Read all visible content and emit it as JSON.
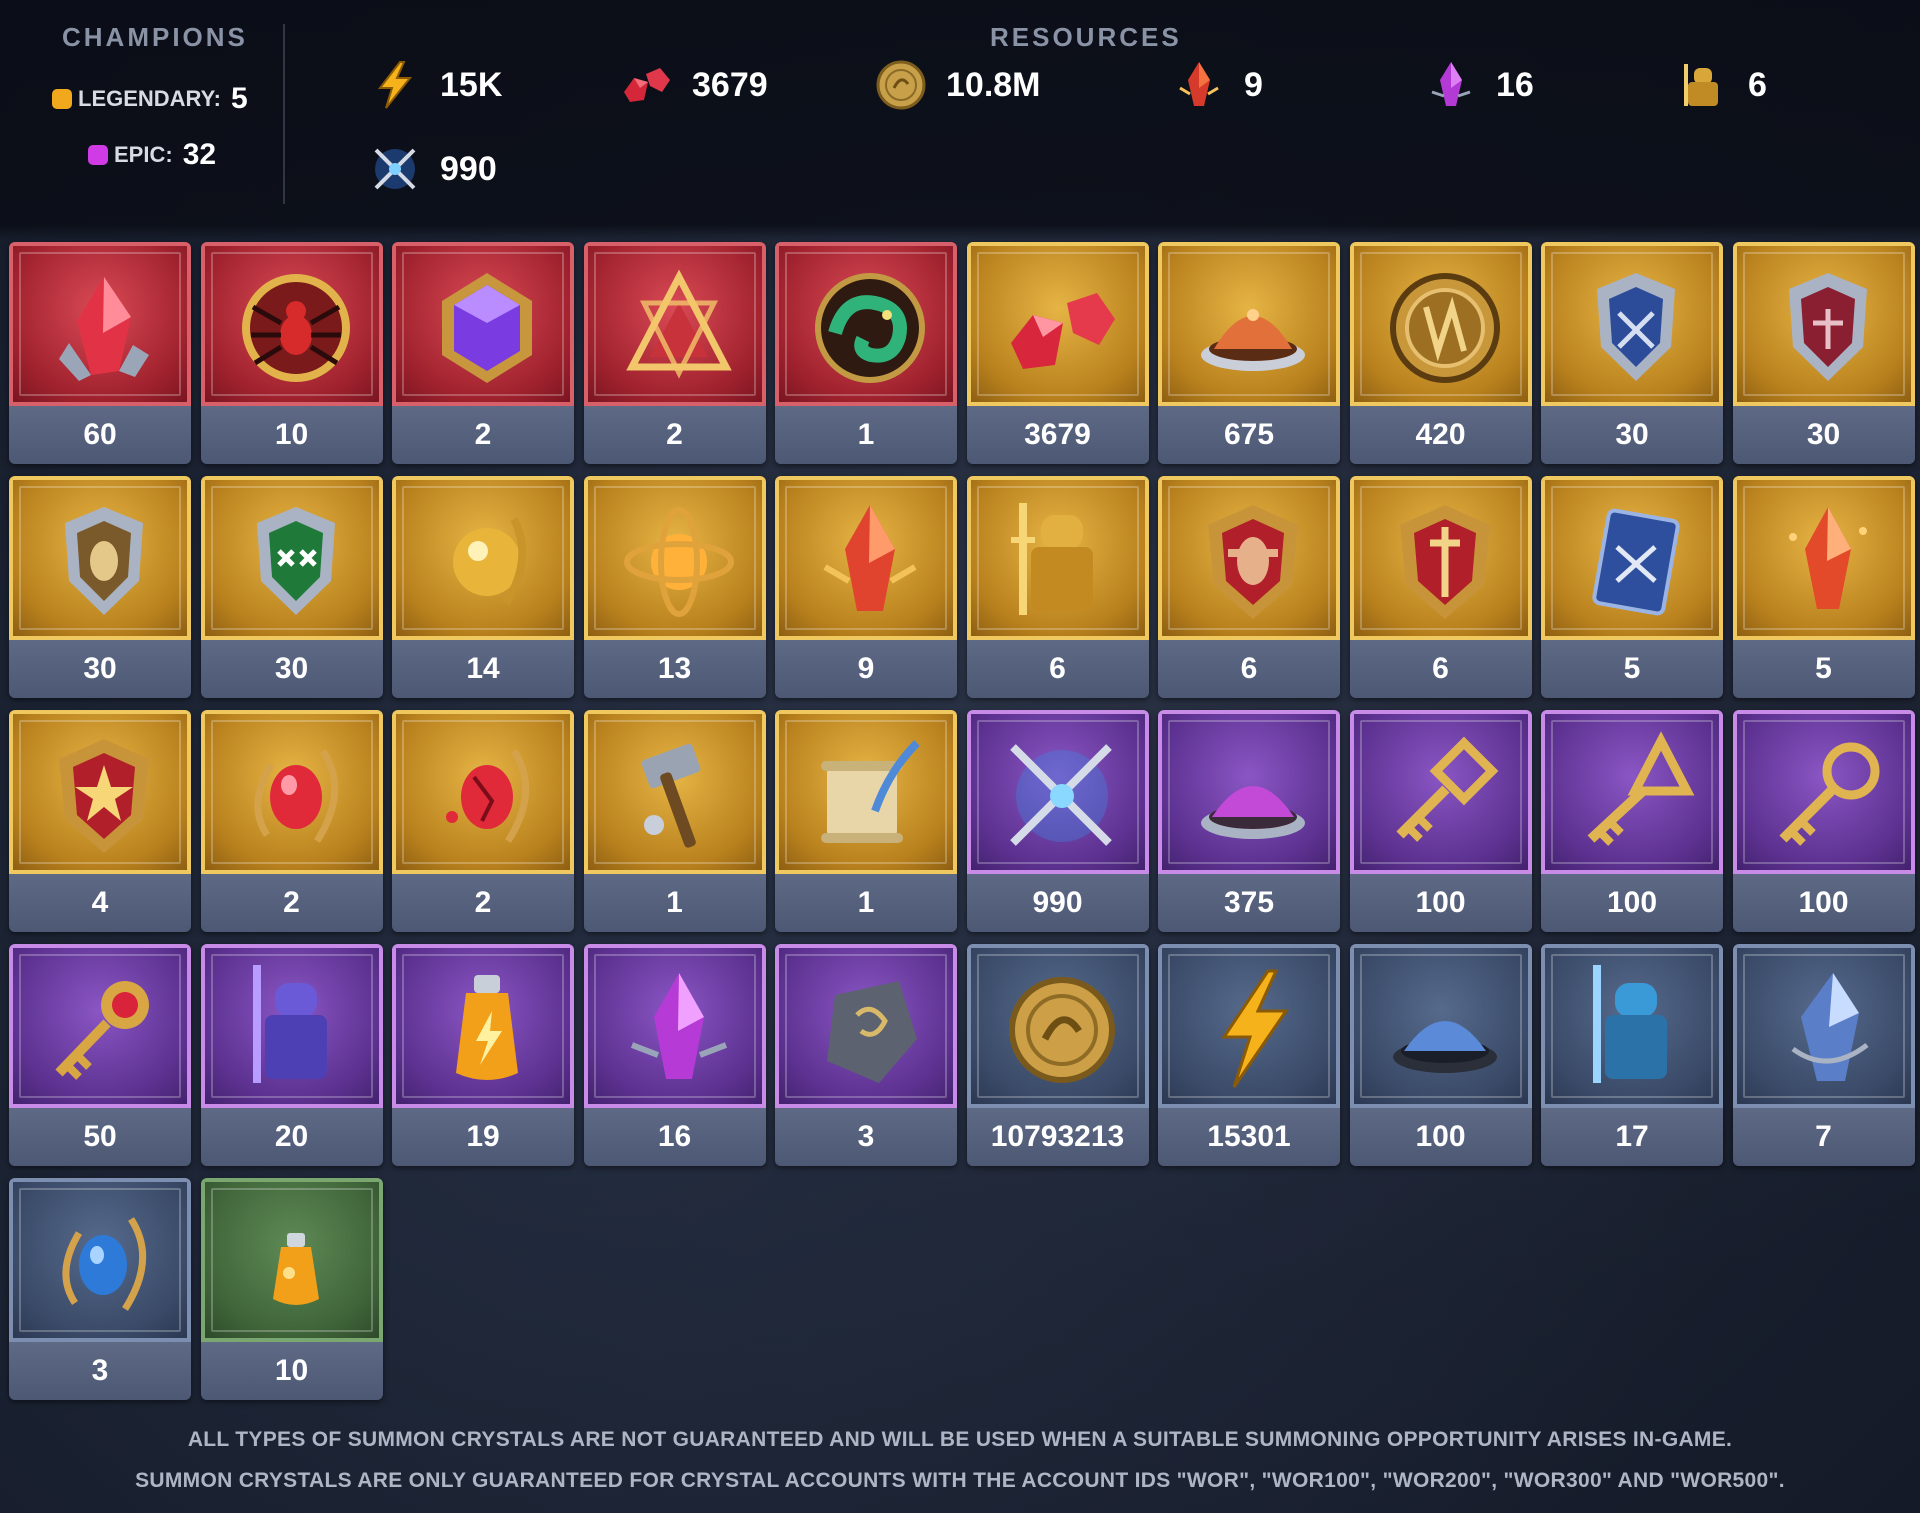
{
  "header": {
    "champions_title": "CHAMPIONS",
    "resources_title": "RESOURCES",
    "champions": [
      {
        "label": "LEGENDARY:",
        "value": "5",
        "color": "#f2a81d"
      },
      {
        "label": "EPIC:",
        "value": "32",
        "color": "#d13be6"
      }
    ],
    "resources": [
      {
        "icon": "energy-bolt-icon",
        "value": "15K"
      },
      {
        "icon": "ruby-gems-icon",
        "value": "3679"
      },
      {
        "icon": "silver-coin-icon",
        "value": "10.8M"
      },
      {
        "icon": "red-shard-icon",
        "value": "9"
      },
      {
        "icon": "purple-shard-icon",
        "value": "16"
      },
      {
        "icon": "golden-knight-icon",
        "value": "6"
      },
      {
        "icon": "crossed-swords-icon",
        "value": "990"
      }
    ]
  },
  "items": [
    {
      "icon": "red-crystal-icon",
      "rarity": "red",
      "count": "60"
    },
    {
      "icon": "spider-medallion-icon",
      "rarity": "red",
      "count": "10"
    },
    {
      "icon": "violet-gem-icon",
      "rarity": "red",
      "count": "2"
    },
    {
      "icon": "triangle-relic-icon",
      "rarity": "red",
      "count": "2"
    },
    {
      "icon": "chameleon-icon",
      "rarity": "red",
      "count": "1"
    },
    {
      "icon": "ruby-gems-icon",
      "rarity": "gold",
      "count": "3679"
    },
    {
      "icon": "forge-dust-icon",
      "rarity": "gold",
      "count": "675"
    },
    {
      "icon": "gold-coin-icon",
      "rarity": "gold",
      "count": "420"
    },
    {
      "icon": "blue-shield-icon",
      "rarity": "gold",
      "count": "30"
    },
    {
      "icon": "red-shield-icon",
      "rarity": "gold",
      "count": "30"
    },
    {
      "icon": "bronze-shield-icon",
      "rarity": "gold",
      "count": "30"
    },
    {
      "icon": "green-shield-icon",
      "rarity": "gold",
      "count": "30"
    },
    {
      "icon": "golden-orb-icon",
      "rarity": "gold",
      "count": "14"
    },
    {
      "icon": "astrolabe-icon",
      "rarity": "gold",
      "count": "13"
    },
    {
      "icon": "red-shard-icon",
      "rarity": "gold",
      "count": "9"
    },
    {
      "icon": "golden-knight-icon",
      "rarity": "gold",
      "count": "6"
    },
    {
      "icon": "strength-crest-icon",
      "rarity": "gold",
      "count": "6"
    },
    {
      "icon": "sword-crest-icon",
      "rarity": "gold",
      "count": "6"
    },
    {
      "icon": "blue-card-icon",
      "rarity": "gold",
      "count": "5"
    },
    {
      "icon": "ember-shard-icon",
      "rarity": "gold",
      "count": "5"
    },
    {
      "icon": "star-crest-icon",
      "rarity": "gold",
      "count": "4"
    },
    {
      "icon": "ruby-amulet-icon",
      "rarity": "gold",
      "count": "2"
    },
    {
      "icon": "ruby-amulet-cracked-icon",
      "rarity": "gold",
      "count": "2"
    },
    {
      "icon": "hammer-icon",
      "rarity": "gold",
      "count": "1"
    },
    {
      "icon": "scroll-quill-icon",
      "rarity": "gold",
      "count": "1"
    },
    {
      "icon": "crossed-swords-icon",
      "rarity": "purple",
      "count": "990"
    },
    {
      "icon": "purple-dust-icon",
      "rarity": "purple",
      "count": "375"
    },
    {
      "icon": "diamond-key-icon",
      "rarity": "purple",
      "count": "100"
    },
    {
      "icon": "triangle-key-icon",
      "rarity": "purple",
      "count": "100"
    },
    {
      "icon": "round-key-icon",
      "rarity": "purple",
      "count": "100"
    },
    {
      "icon": "ruby-key-icon",
      "rarity": "purple",
      "count": "50"
    },
    {
      "icon": "purple-knight-icon",
      "rarity": "purple",
      "count": "20"
    },
    {
      "icon": "energy-potion-icon",
      "rarity": "purple",
      "count": "19"
    },
    {
      "icon": "purple-shard-icon",
      "rarity": "purple",
      "count": "16"
    },
    {
      "icon": "rune-stone-icon",
      "rarity": "purple",
      "count": "3"
    },
    {
      "icon": "silver-coin-icon",
      "rarity": "blue",
      "count": "10793213"
    },
    {
      "icon": "energy-bolt-icon",
      "rarity": "blue",
      "count": "15301"
    },
    {
      "icon": "blue-dust-icon",
      "rarity": "blue",
      "count": "100"
    },
    {
      "icon": "blue-knight-icon",
      "rarity": "blue",
      "count": "17"
    },
    {
      "icon": "blue-crystal-icon",
      "rarity": "blue",
      "count": "7"
    },
    {
      "icon": "sapphire-amulet-icon",
      "rarity": "blue",
      "count": "3"
    },
    {
      "icon": "small-potion-icon",
      "rarity": "green",
      "count": "10"
    }
  ],
  "footer": {
    "line1": "ALL TYPES OF SUMMON CRYSTALS ARE NOT GUARANTEED AND WILL BE USED WHEN A SUITABLE SUMMONING OPPORTUNITY ARISES IN-GAME.",
    "line2": "SUMMON CRYSTALS ARE ONLY GUARANTEED FOR CRYSTAL ACCOUNTS WITH THE ACCOUNT IDS \"WOR\", \"WOR100\", \"WOR200\", \"WOR300\" AND \"WOR500\"."
  }
}
